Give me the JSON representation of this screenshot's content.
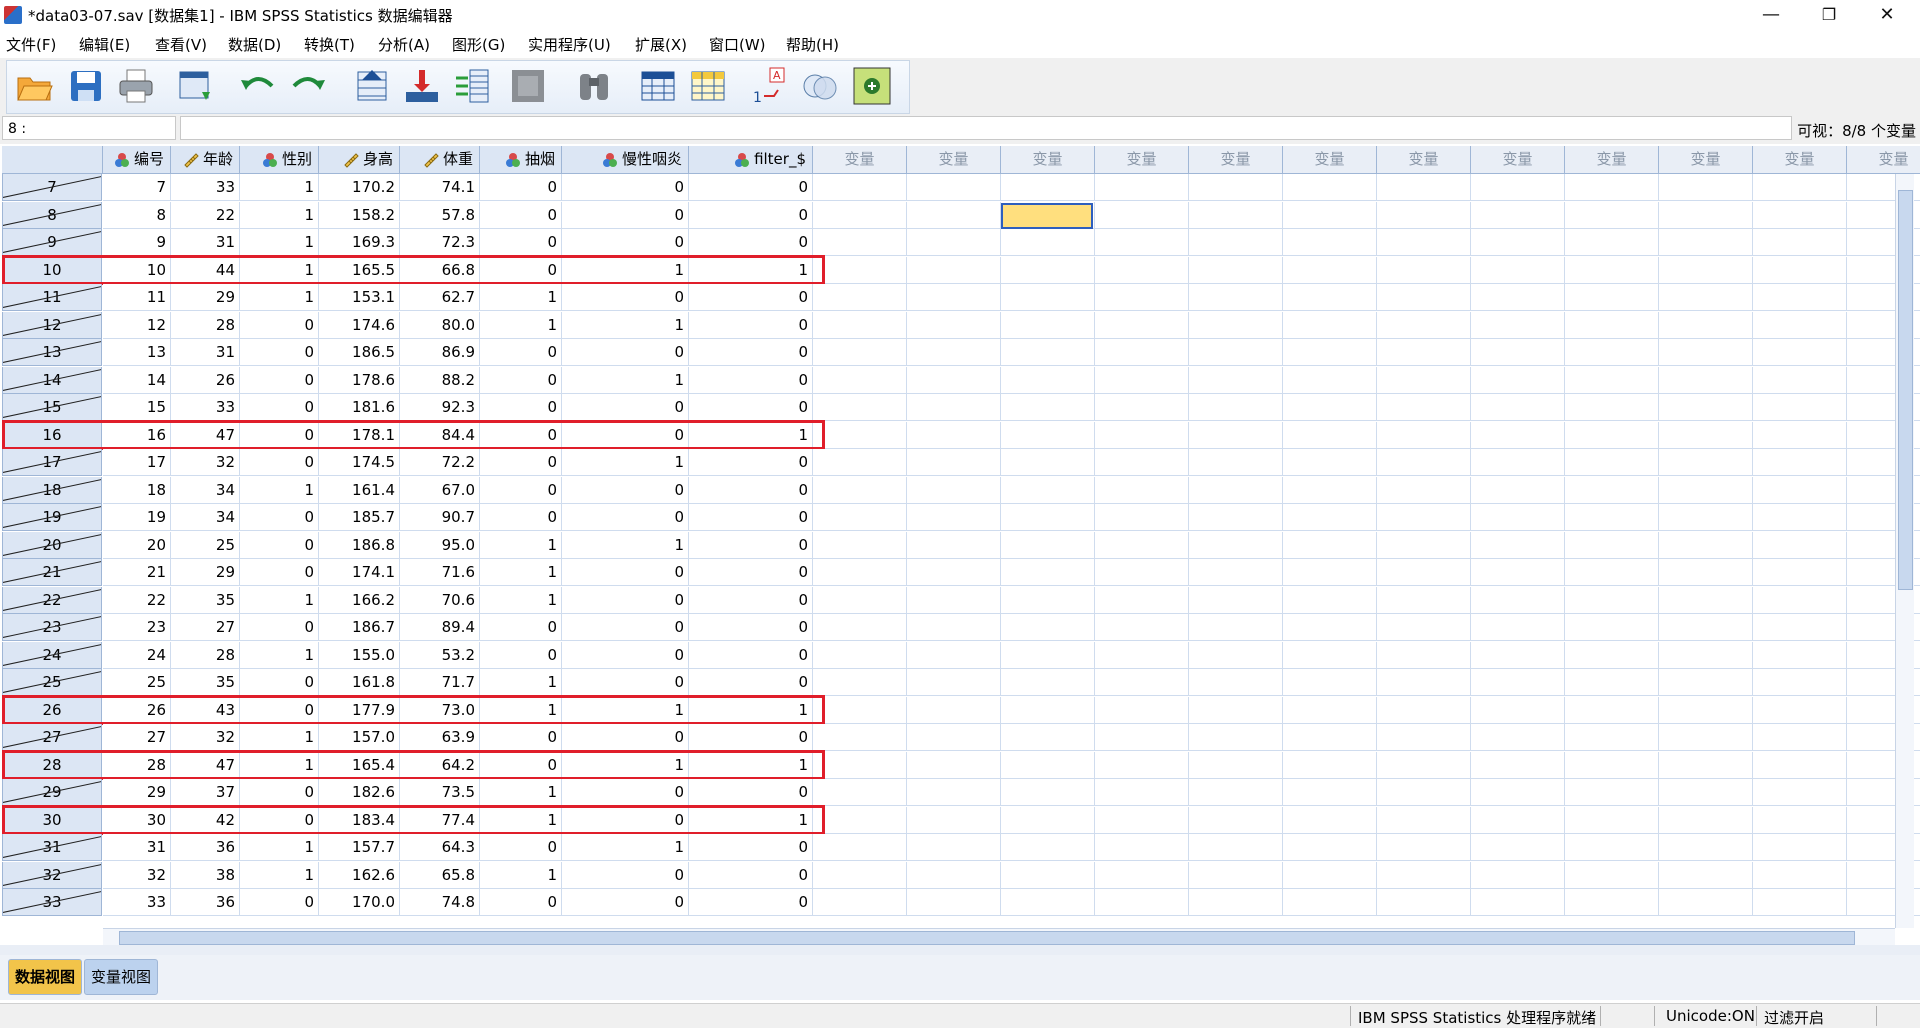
{
  "window": {
    "title": "*data03-07.sav [数据集1] - IBM SPSS Statistics 数据编辑器",
    "minimize": "—",
    "restore": "❐",
    "close": "✕"
  },
  "menu": [
    "文件(F)",
    "编辑(E)",
    "查看(V)",
    "数据(D)",
    "转换(T)",
    "分析(A)",
    "图形(G)",
    "实用程序(U)",
    "扩展(X)",
    "窗口(W)",
    "帮助(H)"
  ],
  "toolbar": {
    "buttons": [
      "open-icon",
      "save-icon",
      "print-icon",
      "recall-dialog-icon",
      "undo-icon",
      "redo-icon",
      "goto-case-icon",
      "goto-variable-icon",
      "variables-icon",
      "run-descriptives-icon",
      "find-icon",
      "insert-cases-icon",
      "insert-variable-icon",
      "split-file-icon",
      "weight-cases-icon",
      "select-cases-icon",
      "value-labels-icon",
      "use-sets-icon"
    ]
  },
  "cell_editor": {
    "reference": "8 :",
    "value": "",
    "visible_label": "可视：8/8 个变量"
  },
  "columns": [
    {
      "label": "编号",
      "icon": "nominal-icon"
    },
    {
      "label": "年龄",
      "icon": "scale-icon"
    },
    {
      "label": "性别",
      "icon": "nominal-icon"
    },
    {
      "label": "身高",
      "icon": "scale-icon"
    },
    {
      "label": "体重",
      "icon": "scale-icon"
    },
    {
      "label": "抽烟",
      "icon": "nominal-icon"
    },
    {
      "label": "慢性咽炎",
      "icon": "nominal-icon"
    },
    {
      "label": "filter_$",
      "icon": "nominal-icon"
    }
  ],
  "empty_column_label": "变量",
  "empty_column_count": 12,
  "rows": [
    {
      "case": "7",
      "filtered": true,
      "values": [
        "7",
        "33",
        "1",
        "170.2",
        "74.1",
        "0",
        "0",
        "0"
      ]
    },
    {
      "case": "8",
      "filtered": true,
      "values": [
        "8",
        "22",
        "1",
        "158.2",
        "57.8",
        "0",
        "0",
        "0"
      ]
    },
    {
      "case": "9",
      "filtered": true,
      "values": [
        "9",
        "31",
        "1",
        "169.3",
        "72.3",
        "0",
        "0",
        "0"
      ]
    },
    {
      "case": "10",
      "filtered": false,
      "values": [
        "10",
        "44",
        "1",
        "165.5",
        "66.8",
        "0",
        "1",
        "1"
      ]
    },
    {
      "case": "11",
      "filtered": true,
      "values": [
        "11",
        "29",
        "1",
        "153.1",
        "62.7",
        "1",
        "0",
        "0"
      ]
    },
    {
      "case": "12",
      "filtered": true,
      "values": [
        "12",
        "28",
        "0",
        "174.6",
        "80.0",
        "1",
        "1",
        "0"
      ]
    },
    {
      "case": "13",
      "filtered": true,
      "values": [
        "13",
        "31",
        "0",
        "186.5",
        "86.9",
        "0",
        "0",
        "0"
      ]
    },
    {
      "case": "14",
      "filtered": true,
      "values": [
        "14",
        "26",
        "0",
        "178.6",
        "88.2",
        "0",
        "1",
        "0"
      ]
    },
    {
      "case": "15",
      "filtered": true,
      "values": [
        "15",
        "33",
        "0",
        "181.6",
        "92.3",
        "0",
        "0",
        "0"
      ]
    },
    {
      "case": "16",
      "filtered": false,
      "values": [
        "16",
        "47",
        "0",
        "178.1",
        "84.4",
        "0",
        "0",
        "1"
      ]
    },
    {
      "case": "17",
      "filtered": true,
      "values": [
        "17",
        "32",
        "0",
        "174.5",
        "72.2",
        "0",
        "1",
        "0"
      ]
    },
    {
      "case": "18",
      "filtered": true,
      "values": [
        "18",
        "34",
        "1",
        "161.4",
        "67.0",
        "0",
        "0",
        "0"
      ]
    },
    {
      "case": "19",
      "filtered": true,
      "values": [
        "19",
        "34",
        "0",
        "185.7",
        "90.7",
        "0",
        "0",
        "0"
      ]
    },
    {
      "case": "20",
      "filtered": true,
      "values": [
        "20",
        "25",
        "0",
        "186.8",
        "95.0",
        "1",
        "1",
        "0"
      ]
    },
    {
      "case": "21",
      "filtered": true,
      "values": [
        "21",
        "29",
        "0",
        "174.1",
        "71.6",
        "1",
        "0",
        "0"
      ]
    },
    {
      "case": "22",
      "filtered": true,
      "values": [
        "22",
        "35",
        "1",
        "166.2",
        "70.6",
        "1",
        "0",
        "0"
      ]
    },
    {
      "case": "23",
      "filtered": true,
      "values": [
        "23",
        "27",
        "0",
        "186.7",
        "89.4",
        "0",
        "0",
        "0"
      ]
    },
    {
      "case": "24",
      "filtered": true,
      "values": [
        "24",
        "28",
        "1",
        "155.0",
        "53.2",
        "0",
        "0",
        "0"
      ]
    },
    {
      "case": "25",
      "filtered": true,
      "values": [
        "25",
        "35",
        "0",
        "161.8",
        "71.7",
        "1",
        "0",
        "0"
      ]
    },
    {
      "case": "26",
      "filtered": false,
      "values": [
        "26",
        "43",
        "0",
        "177.9",
        "73.0",
        "1",
        "1",
        "1"
      ]
    },
    {
      "case": "27",
      "filtered": true,
      "values": [
        "27",
        "32",
        "1",
        "157.0",
        "63.9",
        "0",
        "0",
        "0"
      ]
    },
    {
      "case": "28",
      "filtered": false,
      "values": [
        "28",
        "47",
        "1",
        "165.4",
        "64.2",
        "0",
        "1",
        "1"
      ]
    },
    {
      "case": "29",
      "filtered": true,
      "values": [
        "29",
        "37",
        "0",
        "182.6",
        "73.5",
        "1",
        "0",
        "0"
      ]
    },
    {
      "case": "30",
      "filtered": false,
      "values": [
        "30",
        "42",
        "0",
        "183.4",
        "77.4",
        "1",
        "0",
        "1"
      ]
    },
    {
      "case": "31",
      "filtered": true,
      "values": [
        "31",
        "36",
        "1",
        "157.7",
        "64.3",
        "0",
        "1",
        "0"
      ]
    },
    {
      "case": "32",
      "filtered": true,
      "values": [
        "32",
        "38",
        "1",
        "162.6",
        "65.8",
        "1",
        "0",
        "0"
      ]
    },
    {
      "case": "33",
      "filtered": true,
      "values": [
        "33",
        "36",
        "0",
        "170.0",
        "74.8",
        "0",
        "0",
        "0"
      ]
    }
  ],
  "highlighted_rows": [
    "10",
    "16",
    "26",
    "28",
    "30"
  ],
  "tabs": {
    "data_view": "数据视图",
    "variable_view": "变量视图"
  },
  "status": {
    "processor": "IBM SPSS Statistics 处理程序就绪",
    "unicode": "Unicode:ON",
    "filter": "过滤开启"
  },
  "colors": {
    "highlight_border": "#e01e2a",
    "selected_cell": "#ffdf7e",
    "header_bg": "#dce6f4"
  }
}
